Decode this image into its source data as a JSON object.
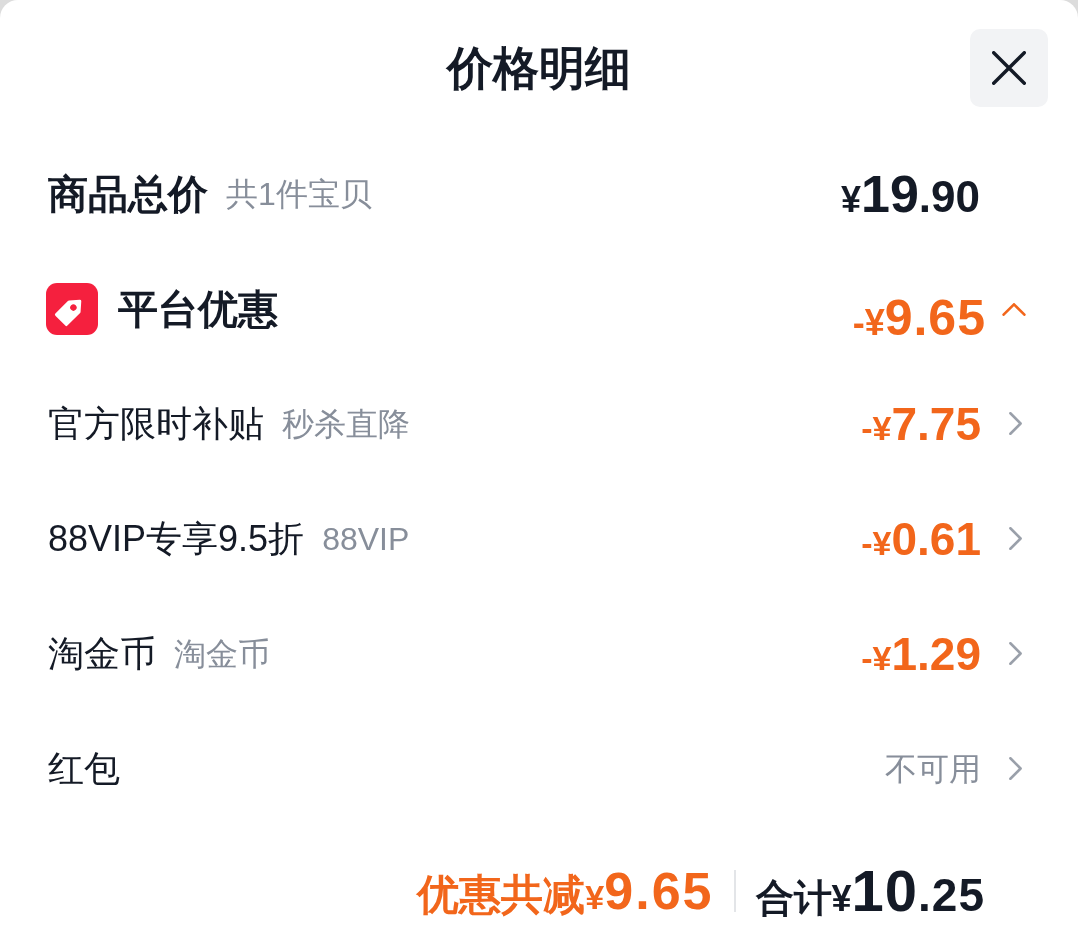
{
  "title": "价格明细",
  "subtotal": {
    "label": "商品总价",
    "note": "共1件宝贝",
    "price": {
      "currency": "¥",
      "whole": "19",
      "fraction": ".90"
    }
  },
  "platform_discount": {
    "label": "平台优惠",
    "amount": {
      "prefix": "-¥",
      "value": "9.65"
    },
    "expanded": true,
    "items": [
      {
        "label": "官方限时补贴",
        "note": "秒杀直降",
        "amount": {
          "prefix": "-¥",
          "value": "7.75"
        }
      },
      {
        "label": "88VIP专享9.5折",
        "note": "88VIP",
        "amount": {
          "prefix": "-¥",
          "value": "0.61"
        }
      },
      {
        "label": "淘金币",
        "note": "淘金币",
        "amount": {
          "prefix": "-¥",
          "value": "1.29"
        }
      }
    ]
  },
  "red_packet": {
    "label": "红包",
    "status": "不可用"
  },
  "summary": {
    "discount_label": "优惠共减",
    "discount_amount": {
      "currency": "¥",
      "value": "9.65"
    },
    "total_label": "合计",
    "total_amount": {
      "currency": "¥",
      "whole": "10",
      "fraction": ".25"
    }
  }
}
